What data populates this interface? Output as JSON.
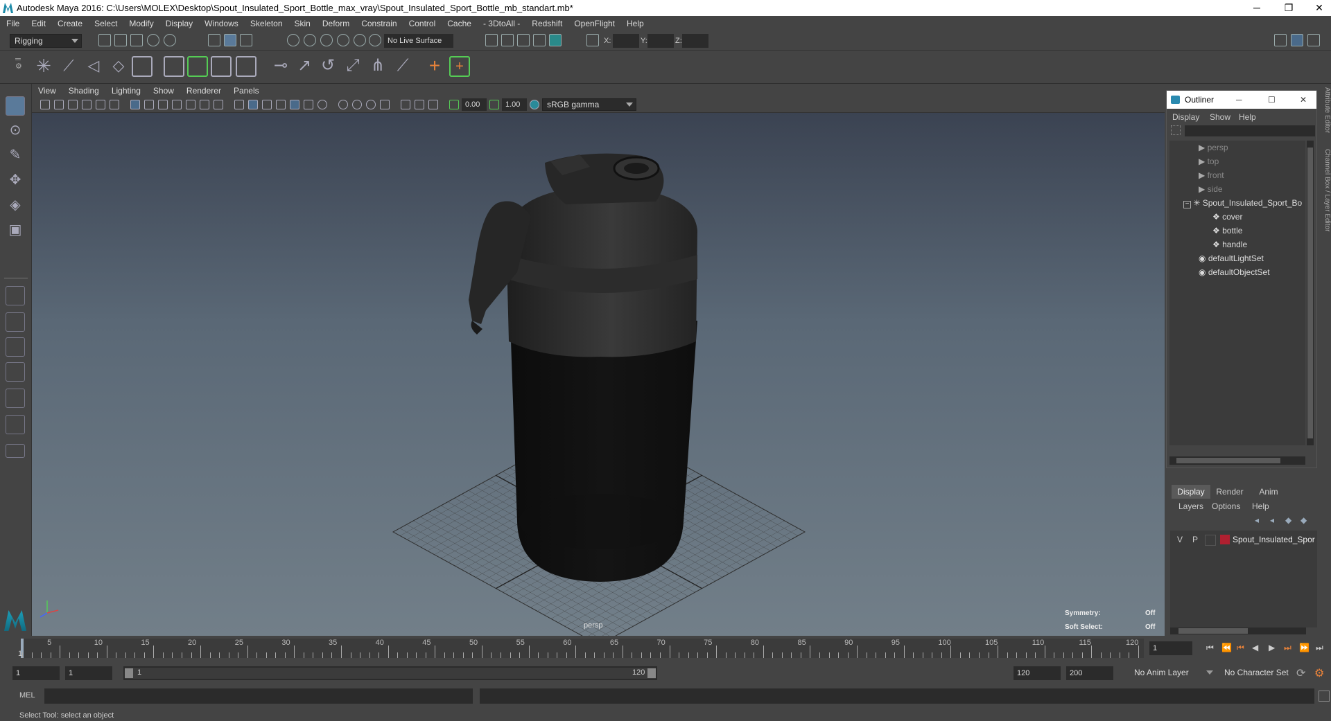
{
  "window": {
    "title": "Autodesk Maya 2016: C:\\Users\\MOLEX\\Desktop\\Spout_Insulated_Sport_Bottle_max_vray\\Spout_Insulated_Sport_Bottle_mb_standart.mb*",
    "minimize": "─",
    "restore": "❐",
    "close": "✕"
  },
  "menubar": [
    "File",
    "Edit",
    "Create",
    "Select",
    "Modify",
    "Display",
    "Windows",
    "Skeleton",
    "Skin",
    "Deform",
    "Constrain",
    "Control",
    "Cache",
    "- 3DtoAll -",
    "Redshift",
    "OpenFlight",
    "Help"
  ],
  "status": {
    "mode": "Rigging",
    "live_surface": "No Live Surface",
    "x_label": "X:",
    "y_label": "Y:",
    "z_label": "Z:"
  },
  "panel_menu": [
    "View",
    "Shading",
    "Lighting",
    "Show",
    "Renderer",
    "Panels"
  ],
  "panel_tools": {
    "exposure": "0.00",
    "gamma": "1.00",
    "color_space": "sRGB gamma"
  },
  "viewport": {
    "camera": "persp",
    "symmetry_label": "Symmetry:",
    "symmetry_value": "Off",
    "soft_select_label": "Soft Select:",
    "soft_select_value": "Off",
    "axis_x": "x",
    "axis_y": "y",
    "axis_z": "z"
  },
  "outliner": {
    "title": "Outliner",
    "menu": [
      "Display",
      "Show",
      "Help"
    ],
    "items": [
      {
        "label": "persp",
        "type": "camera"
      },
      {
        "label": "top",
        "type": "camera"
      },
      {
        "label": "front",
        "type": "camera"
      },
      {
        "label": "side",
        "type": "camera"
      },
      {
        "label": "Spout_Insulated_Sport_Bo",
        "type": "group"
      },
      {
        "label": "cover",
        "type": "mesh"
      },
      {
        "label": "bottle",
        "type": "mesh"
      },
      {
        "label": "handle",
        "type": "mesh"
      },
      {
        "label": "defaultLightSet",
        "type": "set"
      },
      {
        "label": "defaultObjectSet",
        "type": "set"
      }
    ]
  },
  "layer_editor": {
    "tabs": [
      "Display",
      "Render",
      "Anim"
    ],
    "menu": [
      "Layers",
      "Options",
      "Help"
    ],
    "layer": {
      "visible": "V",
      "playback": "P",
      "name": "Spout_Insulated_Spor",
      "color": "#b02030"
    }
  },
  "side_tabs": {
    "attr": "Attribute Editor",
    "channel": "Channel Box / Layer Editor"
  },
  "timeline": {
    "ticks": [
      "1",
      "5",
      "10",
      "15",
      "20",
      "25",
      "30",
      "35",
      "40",
      "45",
      "50",
      "55",
      "60",
      "65",
      "70",
      "75",
      "80",
      "85",
      "90",
      "95",
      "100",
      "105",
      "110",
      "115",
      "120"
    ],
    "current_frame": "1"
  },
  "range": {
    "start": "1",
    "current": "1",
    "range_start": "1",
    "range_end": "120",
    "end": "120",
    "max_end": "200",
    "anim_layer": "No Anim Layer",
    "character_set": "No Character Set"
  },
  "command": {
    "language": "MEL"
  },
  "help_text": "Select Tool: select an object"
}
